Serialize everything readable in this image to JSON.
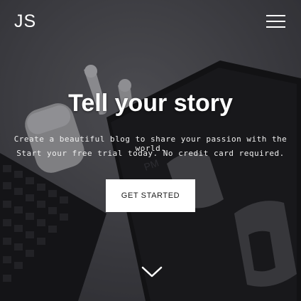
{
  "header": {
    "logo": "JS",
    "menu_icon": "hamburger-menu-icon"
  },
  "hero": {
    "title": "Tell your story",
    "subtitle_line1": "Create a beautiful blog to share your passion with the world.",
    "subtitle_line2": "Start your free trial today. No credit card required.",
    "cta_label": "GET STARTED",
    "scroll_icon": "chevron-down-icon",
    "background_description_icons": [
      "airpods-icon",
      "keyboard-icon",
      "phone-clock-icon"
    ],
    "colors": {
      "text": "#ffffff",
      "button_bg": "#ffffff",
      "button_text": "#1a1a1a",
      "background": "#2a2a2e"
    }
  }
}
